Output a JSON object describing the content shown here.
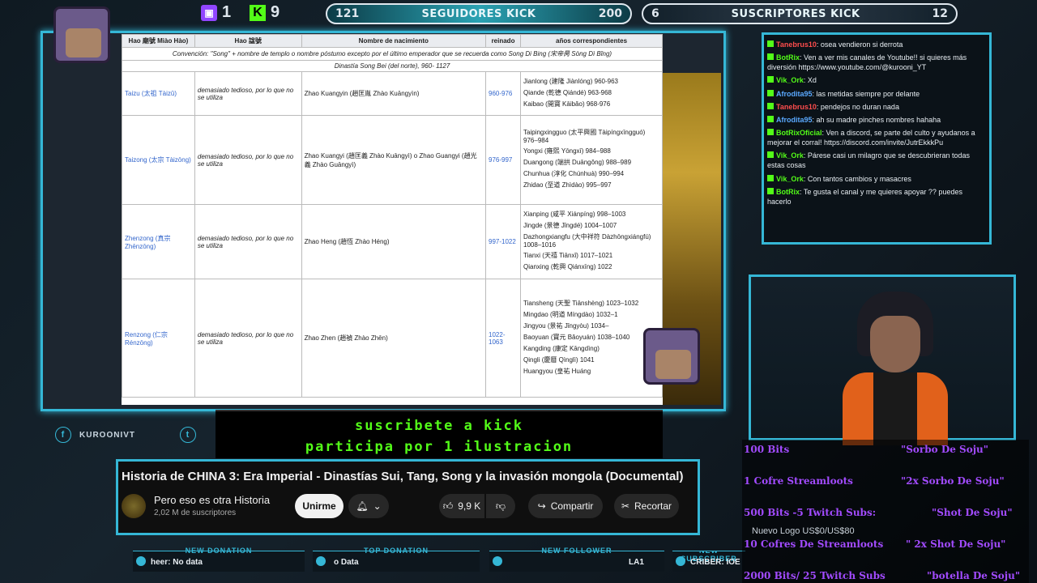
{
  "top": {
    "twitch_count": "1",
    "kick_count": "9",
    "followers": {
      "current": "121",
      "label": "SEGUIDORES KICK",
      "goal": "200"
    },
    "subscribers": {
      "current": "6",
      "label": "SUSCRIPTORES KICK",
      "goal": "12"
    }
  },
  "doc": {
    "headers": [
      "Hao 廟號 Miào Hào)",
      "Hao 諡號",
      "Nombre de nacimiento",
      "reinado",
      "años correspondientes"
    ],
    "convention": "Convención: \"Song\" + nombre de templo o nombre póstumo excepto por el último emperador que se recuerda como Song Di Bing (宋帝昺 Sòng Dì Bǐng)",
    "dynasty": "Dinastía Song Bei (del norte), 960- 1127",
    "rows": [
      {
        "temple": "Taizu (太祖 Tàizǔ)",
        "posthumous": "demasiado tedioso, por lo que no se utiliza",
        "birth": "Zhao Kuangyin (趙匡胤 Zhào Kuāngyìn)",
        "reign": "960-976",
        "eras": [
          "Jianlong (建隆 Jiànlóng) 960-963",
          "Qiande (乾德 Qiándé) 963-968",
          "Kaibao (開寶 Kāibǎo) 968-976"
        ]
      },
      {
        "temple": "Taizong (太宗 Tàizōng)",
        "posthumous": "demasiado tedioso, por lo que no se utiliza",
        "birth": "Zhao Kuangyi (趙匡義 Zhào Kuāngyì) o Zhao Guangyi (趙光義 Zhào Guāngyì)",
        "reign": "976-997",
        "eras": [
          "Taipingxingguo (太平興國 Tàipíngxīngguó) 976–984",
          "Yongxi (雍熙 Yōngxī) 984–988",
          "Duangong (端拱 Duāngǒng) 988–989",
          "Chunhua (淳化 Chúnhuà) 990–994",
          "Zhidao (至道 Zhìdào) 995–997"
        ]
      },
      {
        "temple": "Zhenzong (真宗 Zhēnzōng)",
        "posthumous": "demasiado tedioso, por lo que no se utiliza",
        "birth": "Zhao Heng (趙恆 Zhào Héng)",
        "reign": "997-1022",
        "eras": [
          "Xianping (咸平 Xiánpíng) 998–1003",
          "Jingde (景德 Jǐngdé) 1004–1007",
          "Dazhongxiangfu (大中祥符 Dàzhōngxiángfú) 1008–1016",
          "Tianxi (天禧 Tiānxǐ) 1017–1021",
          "Qianxing (乾興 Qiánxīng) 1022"
        ]
      },
      {
        "temple": "Renzong (仁宗 Rénzōng)",
        "posthumous": "demasiado tedioso, por lo que no se utiliza",
        "birth": "Zhao Zhen (趙禎 Zhào Zhēn)",
        "reign": "1022-1063",
        "eras": [
          "Tiansheng (天聖 Tiānshèng) 1023–1032",
          "Mingdao (明道 Míngdào) 1032–1",
          "Jingyou (景祐 Jǐngyòu) 1034–",
          "Baoyuan (寶元 Bǎoyuán) 1038–1040",
          "Kangding (康定 Kāngdìng)",
          "Qingli (慶曆 Qìnglì) 1041",
          "Huangyou (皇祐 Huáng"
        ]
      }
    ]
  },
  "socials": {
    "facebook": "KUROONIVT",
    "twitter": ""
  },
  "banner": {
    "line1": "suscribete a kick",
    "line2": "participa por 1 ilustracion"
  },
  "youtube": {
    "title": "Historia de CHINA 3: Era Imperial - Dinastías Sui, Tang, Song y la invasión mongola (Documental)",
    "channel": "Pero eso es otra Historia",
    "subscribers": "2,02 M de suscriptores",
    "join": "Unirme",
    "likes": "9,9 K",
    "share": "Compartir",
    "clip": "Recortar"
  },
  "alerts": [
    {
      "label": "NEW DONATION",
      "value": "heer: No data"
    },
    {
      "label": "TOP DONATION",
      "value": "o Data"
    },
    {
      "label": "NEW FOLLOWER",
      "value": "LA1"
    },
    {
      "label": "NEW SUBSCRIBER",
      "value": "CRIBER: IOE"
    }
  ],
  "chat": [
    {
      "user": "Tanebrus10",
      "text": ": osea vendieron si derrota",
      "color": "#ff4d4d"
    },
    {
      "user": "BotRix",
      "text": ": Ven a ver mis canales de Youtube!! si quieres más diversión https://www.youtube.com/@kurooni_YT",
      "color": "#53fc18"
    },
    {
      "user": "Vik_Ork",
      "text": ": Xd",
      "color": "#53fc18"
    },
    {
      "user": "Afrodita95",
      "text": ": las metidas siempre por delante",
      "color": "#5aa9ff"
    },
    {
      "user": "Tanebrus10",
      "text": ": pendejos no duran nada",
      "color": "#ff4d4d"
    },
    {
      "user": "Afrodita95",
      "text": ": ah su madre pinches nombres hahaha",
      "color": "#5aa9ff"
    },
    {
      "user": "BotRixOficial",
      "text": ": Ven a discord, se parte del culto y ayudanos a mejorar el corral! https://discord.com/invite/JutrEkkkPu",
      "color": "#53fc18"
    },
    {
      "user": "Vik_Ork",
      "text": ": Párese casi un milagro que se descubrieran todas estas cosas",
      "color": "#53fc18"
    },
    {
      "user": "Vik_Ork",
      "text": ": Con tantos cambios y masacres",
      "color": "#53fc18"
    },
    {
      "user": "BotRix",
      "text": ": Te gusta el canal y me quieres apoyar ?? puedes hacerlo",
      "color": "#53fc18"
    }
  ],
  "rewards": [
    {
      "left": "100 Bits",
      "right": "\"Sorbo De Soju\""
    },
    {
      "left": "1 Cofre Streamloots",
      "right": "\"2x Sorbo De Soju\""
    },
    {
      "left": "500 Bits -5 Twitch Subs:",
      "right": "\"Shot De Soju\""
    },
    {
      "left": "10 Cofres De Streamloots",
      "right": "\" 2x Shot De Soju\""
    },
    {
      "left": "2000 Bits/ 25 Twitch Subs",
      "right": "\"botella De Soju\""
    }
  ],
  "nuevo_logo": "Nuevo Logo US$0/US$80"
}
